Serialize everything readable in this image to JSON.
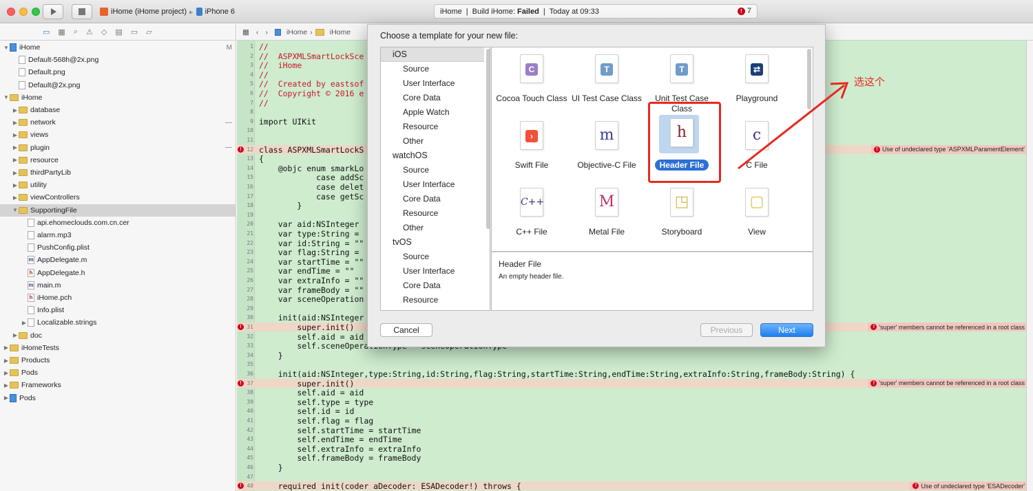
{
  "toolbar": {
    "scheme_project": "iHome (iHome project)",
    "scheme_device": "iPhone 6",
    "status_project": "iHome",
    "status_build_label": "Build iHome:",
    "status_build_result": "Failed",
    "status_time": "Today at 09:33",
    "error_count": "7",
    "separator": "|"
  },
  "navigator": {
    "tab_icons": [
      "folder-icon",
      "symbol-icon",
      "search-icon",
      "issue-icon",
      "test-icon",
      "debug-icon",
      "breakpoint-icon",
      "report-icon"
    ],
    "items": [
      {
        "label": "iHome",
        "depth": 0,
        "kind": "project",
        "mark": "M",
        "open": true
      },
      {
        "label": "Default-568h@2x.png",
        "depth": 1,
        "kind": "file"
      },
      {
        "label": "Default.png",
        "depth": 1,
        "kind": "file"
      },
      {
        "label": "Default@2x.png",
        "depth": 1,
        "kind": "file"
      },
      {
        "label": "iHome",
        "depth": 0,
        "kind": "folder",
        "open": true
      },
      {
        "label": "database",
        "depth": 1,
        "kind": "folder",
        "closed": true
      },
      {
        "label": "network",
        "depth": 1,
        "kind": "folder",
        "closed": true,
        "mark": "—"
      },
      {
        "label": "views",
        "depth": 1,
        "kind": "folder",
        "closed": true
      },
      {
        "label": "plugin",
        "depth": 1,
        "kind": "folder",
        "closed": true,
        "mark": "—"
      },
      {
        "label": "resource",
        "depth": 1,
        "kind": "folder",
        "closed": true
      },
      {
        "label": "thirdPartyLib",
        "depth": 1,
        "kind": "folder",
        "closed": true
      },
      {
        "label": "utility",
        "depth": 1,
        "kind": "folder",
        "closed": true
      },
      {
        "label": "viewControllers",
        "depth": 1,
        "kind": "folder",
        "closed": true
      },
      {
        "label": "SupportingFile",
        "depth": 1,
        "kind": "folder",
        "open": true,
        "selected": true
      },
      {
        "label": "api.ehomeclouds.com.cn.cer",
        "depth": 2,
        "kind": "file"
      },
      {
        "label": "alarm.mp3",
        "depth": 2,
        "kind": "file"
      },
      {
        "label": "PushConfig.plist",
        "depth": 2,
        "kind": "file"
      },
      {
        "label": "AppDelegate.m",
        "depth": 2,
        "kind": "file",
        "badge": "m"
      },
      {
        "label": "AppDelegate.h",
        "depth": 2,
        "kind": "file",
        "badge": "h"
      },
      {
        "label": "main.m",
        "depth": 2,
        "kind": "file",
        "badge": "m"
      },
      {
        "label": "iHome.pch",
        "depth": 2,
        "kind": "file",
        "badge": "h"
      },
      {
        "label": "Info.plist",
        "depth": 2,
        "kind": "file"
      },
      {
        "label": "Localizable.strings",
        "depth": 2,
        "kind": "file",
        "closed": true
      },
      {
        "label": "doc",
        "depth": 1,
        "kind": "folder",
        "closed": true
      },
      {
        "label": "iHomeTests",
        "depth": 0,
        "kind": "folder",
        "closed": true
      },
      {
        "label": "Products",
        "depth": 0,
        "kind": "folder",
        "closed": true
      },
      {
        "label": "Pods",
        "depth": 0,
        "kind": "folder",
        "closed": true
      },
      {
        "label": "Frameworks",
        "depth": 0,
        "kind": "folder",
        "closed": true
      },
      {
        "label": "Pods",
        "depth": 0,
        "kind": "project",
        "closed": true
      }
    ]
  },
  "jumpbar": {
    "crumb1": "iHome",
    "crumb2": "iHome"
  },
  "editor": {
    "line_numbers": [
      "1",
      "2",
      "3",
      "4",
      "5",
      "6",
      "7",
      "8",
      "9",
      "10",
      "11",
      "12",
      "13",
      "14",
      "15",
      "16",
      "17",
      "18",
      "19",
      "20",
      "21",
      "22",
      "23",
      "24",
      "25",
      "26",
      "27",
      "28",
      "29",
      "30",
      "31",
      "32",
      "33",
      "34",
      "35",
      "36",
      "37",
      "38",
      "39",
      "40",
      "41",
      "42",
      "43",
      "44",
      "45",
      "46",
      "47",
      "48"
    ],
    "lines": [
      "//",
      "//  ASPXMLSmartLockSce",
      "//  iHome",
      "//",
      "//  Created by eastsof",
      "//  Copyright © 2016 e",
      "//",
      "",
      "import UIKit",
      "",
      "",
      "class ASPXMLSmartLockS",
      "{",
      "    @objc enum smarkLo",
      "            case addSc",
      "            case delet",
      "            case getSc",
      "        }",
      "",
      "    var aid:NSInteger",
      "    var type:String =",
      "    var id:String = \"\"",
      "    var flag:String =",
      "    var startTime = \"\"",
      "    var endTime = \"\"",
      "    var extraInfo = \"\"",
      "    var frameBody = \"\"",
      "    var sceneOperation",
      "",
      "    init(aid:NSInteger",
      "        super.init()",
      "        self.aid = aid",
      "        self.sceneOperationType = sceneOperationType",
      "    }",
      "",
      "    init(aid:NSInteger,type:String,id:String,flag:String,startTime:String,endTime:String,extraInfo:String,frameBody:String) {",
      "        super.init()",
      "        self.aid = aid",
      "        self.type = type",
      "        self.id = id",
      "        self.flag = flag",
      "        self.startTime = startTime",
      "        self.endTime = endTime",
      "        self.extraInfo = extraInfo",
      "        self.frameBody = frameBody",
      "    }",
      "",
      "    required init(coder aDecoder: ESADecoder!) throws {"
    ],
    "errors": [
      {
        "line": "12",
        "message": "Use of undeclared type 'ASPXMLParamentElement'"
      },
      {
        "line": "31",
        "message": "'super' members cannot be referenced in a root class"
      },
      {
        "line": "37",
        "message": "'super' members cannot be referenced in a root class"
      },
      {
        "line": "48",
        "message": "Use of undeclared type 'ESADecoder'"
      }
    ]
  },
  "dialog": {
    "title": "Choose a template for your new file:",
    "categories": [
      {
        "label": "iOS",
        "header": true,
        "selected": true
      },
      {
        "label": "Source"
      },
      {
        "label": "User Interface"
      },
      {
        "label": "Core Data"
      },
      {
        "label": "Apple Watch"
      },
      {
        "label": "Resource"
      },
      {
        "label": "Other"
      },
      {
        "label": "watchOS",
        "header": true
      },
      {
        "label": "Source"
      },
      {
        "label": "User Interface"
      },
      {
        "label": "Core Data"
      },
      {
        "label": "Resource"
      },
      {
        "label": "Other"
      },
      {
        "label": "tvOS",
        "header": true
      },
      {
        "label": "Source"
      },
      {
        "label": "User Interface"
      },
      {
        "label": "Core Data"
      },
      {
        "label": "Resource"
      }
    ],
    "templates": [
      {
        "label": "Cocoa Touch Class",
        "icon": "C",
        "icon_name": "cocoa-touch-class-icon",
        "color": "#9b7fc7"
      },
      {
        "label": "UI Test Case Class",
        "icon": "T",
        "icon_name": "ui-test-case-icon",
        "color": "#6f9cc9"
      },
      {
        "label": "Unit Test Case Class",
        "icon": "T",
        "icon_name": "unit-test-case-icon",
        "color": "#6f9cc9"
      },
      {
        "label": "Playground",
        "icon": "⇄",
        "icon_name": "playground-icon",
        "color": "#1c3f7a"
      },
      {
        "label": "Swift File",
        "icon": "›",
        "icon_name": "swift-file-icon",
        "color": "#f05138"
      },
      {
        "label": "Objective-C File",
        "icon": "m",
        "icon_name": "objc-file-icon",
        "color": "#3a3a9a"
      },
      {
        "label": "Header File",
        "icon": "h",
        "icon_name": "header-file-icon",
        "color": "#7a1f2a",
        "selected": true
      },
      {
        "label": "C File",
        "icon": "c",
        "icon_name": "c-file-icon",
        "color": "#4a2d8a"
      },
      {
        "label": "C++ File",
        "icon": "C++",
        "icon_name": "cpp-file-icon",
        "color": "#3a2d7a"
      },
      {
        "label": "Metal File",
        "icon": "M",
        "icon_name": "metal-file-icon",
        "color": "#c0306a"
      },
      {
        "label": "Storyboard",
        "icon": "◳",
        "icon_name": "storyboard-icon",
        "color": "#d9b84a"
      },
      {
        "label": "View",
        "icon": "▢",
        "icon_name": "view-icon",
        "color": "#e0c24f"
      }
    ],
    "description_title": "Header File",
    "description_text": "An empty header file.",
    "cancel_label": "Cancel",
    "previous_label": "Previous",
    "next_label": "Next"
  },
  "annotation": {
    "text": "选这个",
    "color": "#e8281e"
  }
}
